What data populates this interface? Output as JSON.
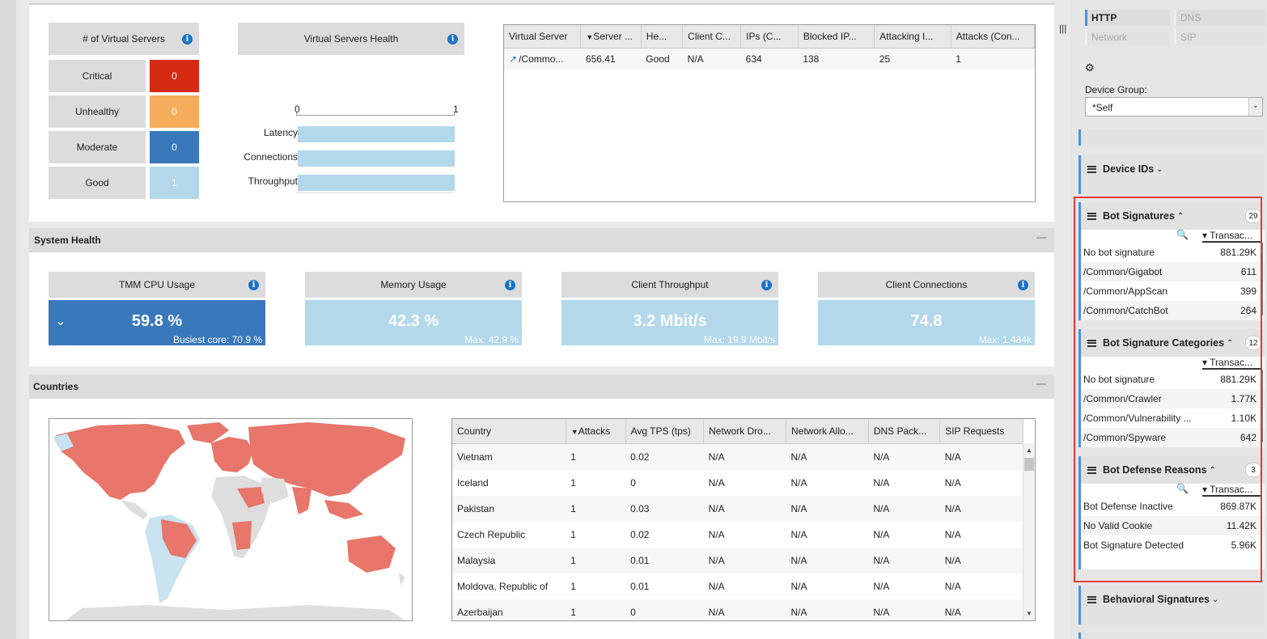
{
  "summary": {
    "vs_header": "# of Virtual Servers",
    "health_rows": [
      {
        "label": "Critical",
        "value": "0",
        "color": "#d52b12"
      },
      {
        "label": "Unhealthy",
        "value": "0",
        "color": "#f5ad5b"
      },
      {
        "label": "Moderate",
        "value": "0",
        "color": "#3a78bc"
      },
      {
        "label": "Good",
        "value": "1",
        "color": "#b3d8eb"
      }
    ],
    "vs_health_title": "Virtual Servers Health",
    "vs_health_axis": [
      "0",
      "1"
    ],
    "vs_health_bars": [
      "Latency",
      "Connections",
      "Throughput"
    ]
  },
  "vs_table": {
    "columns": [
      "Virtual Server",
      "Server ...",
      "He...",
      "Client C...",
      "IPs (C...",
      "Blocked IP...",
      "Attacking I...",
      "Attacks (Con..."
    ],
    "rows": [
      [
        "/Commo...",
        "656.41",
        "Good",
        "N/A",
        "634",
        "138",
        "25",
        "1"
      ]
    ]
  },
  "system_health": {
    "title": "System Health",
    "metrics": [
      {
        "label": "TMM CPU Usage",
        "value": "59.8 %",
        "sub": "Busiest core:  70.9 %"
      },
      {
        "label": "Memory Usage",
        "value": "42.3 %",
        "sub": "Max:  42.9 %"
      },
      {
        "label": "Client Throughput",
        "value": "3.2 Mbit/s",
        "sub": "Max:  19.9 Mbit/s"
      },
      {
        "label": "Client Connections",
        "value": "74.8",
        "sub": "Max:  1.484k"
      }
    ]
  },
  "countries": {
    "title": "Countries",
    "columns": [
      "Country",
      "Attacks",
      "Avg TPS (tps)",
      "Network Dro...",
      "Network Allo...",
      "DNS Pack...",
      "SIP Requests"
    ],
    "rows": [
      [
        "Vietnam",
        "1",
        "0.02",
        "N/A",
        "N/A",
        "N/A",
        "N/A"
      ],
      [
        "Iceland",
        "1",
        "0",
        "N/A",
        "N/A",
        "N/A",
        "N/A"
      ],
      [
        "Pakistan",
        "1",
        "0.03",
        "N/A",
        "N/A",
        "N/A",
        "N/A"
      ],
      [
        "Czech Republic",
        "1",
        "0.02",
        "N/A",
        "N/A",
        "N/A",
        "N/A"
      ],
      [
        "Malaysia",
        "1",
        "0.01",
        "N/A",
        "N/A",
        "N/A",
        "N/A"
      ],
      [
        "Moldova, Republic of",
        "1",
        "0.01",
        "N/A",
        "N/A",
        "N/A",
        "N/A"
      ],
      [
        "Azerbaijan",
        "1",
        "0",
        "N/A",
        "N/A",
        "N/A",
        "N/A"
      ]
    ]
  },
  "sidebar": {
    "tabs": [
      "HTTP",
      "DNS",
      "Network",
      "SIP"
    ],
    "device_group_label": "Device Group:",
    "device_group_value": "*Self",
    "device_ids": "Device IDs",
    "sort_col": "Transac...",
    "bot_signatures": {
      "title": "Bot Signatures",
      "count": "29",
      "rows": [
        [
          "No bot signature",
          "881.29K"
        ],
        [
          "/Common/Gigabot",
          "611"
        ],
        [
          "/Common/AppScan",
          "399"
        ],
        [
          "/Common/CatchBot",
          "264"
        ]
      ]
    },
    "bot_categories": {
      "title": "Bot Signature Categories",
      "count": "12",
      "rows": [
        [
          "No bot signature",
          "881.29K"
        ],
        [
          "/Common/Crawler",
          "1.77K"
        ],
        [
          "/Common/Vulnerability ...",
          "1.10K"
        ],
        [
          "/Common/Spyware",
          "642"
        ]
      ]
    },
    "bot_defense": {
      "title": "Bot Defense Reasons",
      "count": "3",
      "rows": [
        [
          "Bot Defense Inactive",
          "869.87K"
        ],
        [
          "No Valid Cookie",
          "11.42K"
        ],
        [
          "Bot Signature Detected",
          "5.96K"
        ]
      ]
    },
    "behavioral": "Behavioral Signatures"
  }
}
